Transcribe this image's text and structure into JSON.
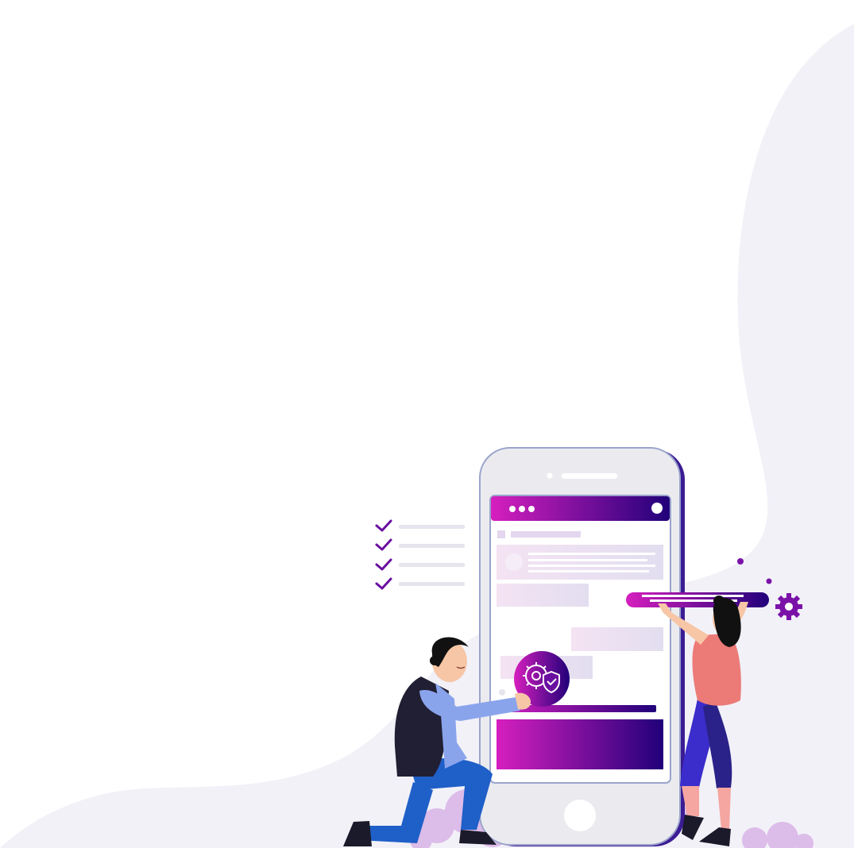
{
  "colors": {
    "page_bg": "#ffffff",
    "blob_bg": "#f2f1f8",
    "accent_magenta": "#d61fbe",
    "accent_indigo": "#21007a",
    "phone_body": "#ebebef",
    "phone_outline": "#9aa3cc",
    "phone_shadow": "#3b1c94",
    "card_tint": "#ece2f2",
    "cloud": "#d9b3e6",
    "man_vest": "#211f33",
    "man_sleeve": "#8aa4ec",
    "man_pants": "#1f5fc8",
    "skin": "#f7c6a6",
    "woman_top": "#ec7a77",
    "woman_pants": "#3b2ccc",
    "hair": "#111111"
  },
  "icons": {
    "checkmarks": [
      "check-icon",
      "check-icon",
      "check-icon",
      "check-icon"
    ],
    "phone_badge": "gear-wifi-shield-icon",
    "floating": "gear-icon",
    "window_controls": [
      "dot-icon",
      "dot-icon",
      "dot-icon"
    ],
    "window_action": "circle-icon"
  }
}
